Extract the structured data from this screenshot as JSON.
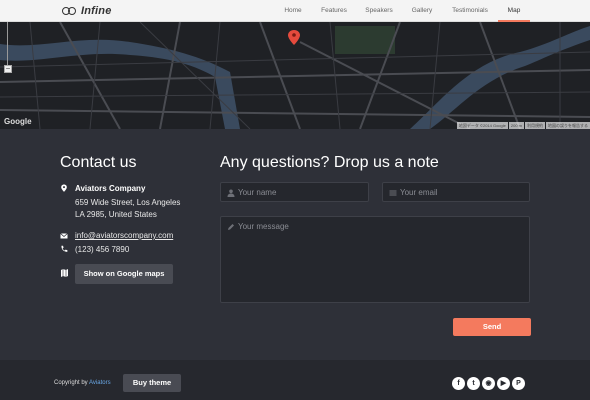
{
  "nav": {
    "brand": "Infine",
    "items": [
      {
        "label": "Home"
      },
      {
        "label": "Features"
      },
      {
        "label": "Speakers"
      },
      {
        "label": "Gallery"
      },
      {
        "label": "Testimonials"
      },
      {
        "label": "Map"
      }
    ]
  },
  "map": {
    "provider": "Google",
    "zoom_out_label": "−",
    "footer": [
      "地図データ ©2014 Google",
      "200 m",
      "利用規約",
      "地図の誤りを報告する"
    ],
    "pin_icon": "map-pin-icon"
  },
  "contact": {
    "title": "Contact us",
    "company": "Aviators Company",
    "address_line1": "659 Wide Street, Los Angeles",
    "address_line2": "LA 2985, United States",
    "email": "info@aviatorscompany.com",
    "phone": "(123) 456 7890",
    "maps_button": "Show on Google maps"
  },
  "form": {
    "title": "Any questions? Drop us a note",
    "name_placeholder": "Your name",
    "email_placeholder": "Your email",
    "message_placeholder": "Your message",
    "send_label": "Send"
  },
  "footer": {
    "copyright_prefix": "Copyright by",
    "copyright_link": "Aviators",
    "buy_label": "Buy theme",
    "social": [
      {
        "icon": "facebook-icon",
        "glyph": "f"
      },
      {
        "icon": "twitter-icon",
        "glyph": "t"
      },
      {
        "icon": "camera-icon",
        "glyph": "◉"
      },
      {
        "icon": "youtube-icon",
        "glyph": "▶"
      },
      {
        "icon": "pinterest-icon",
        "glyph": "P"
      }
    ]
  },
  "colors": {
    "accent": "#f47a5e",
    "background": "#2e3038",
    "footer": "#26282e",
    "link": "#6aa8e6"
  }
}
